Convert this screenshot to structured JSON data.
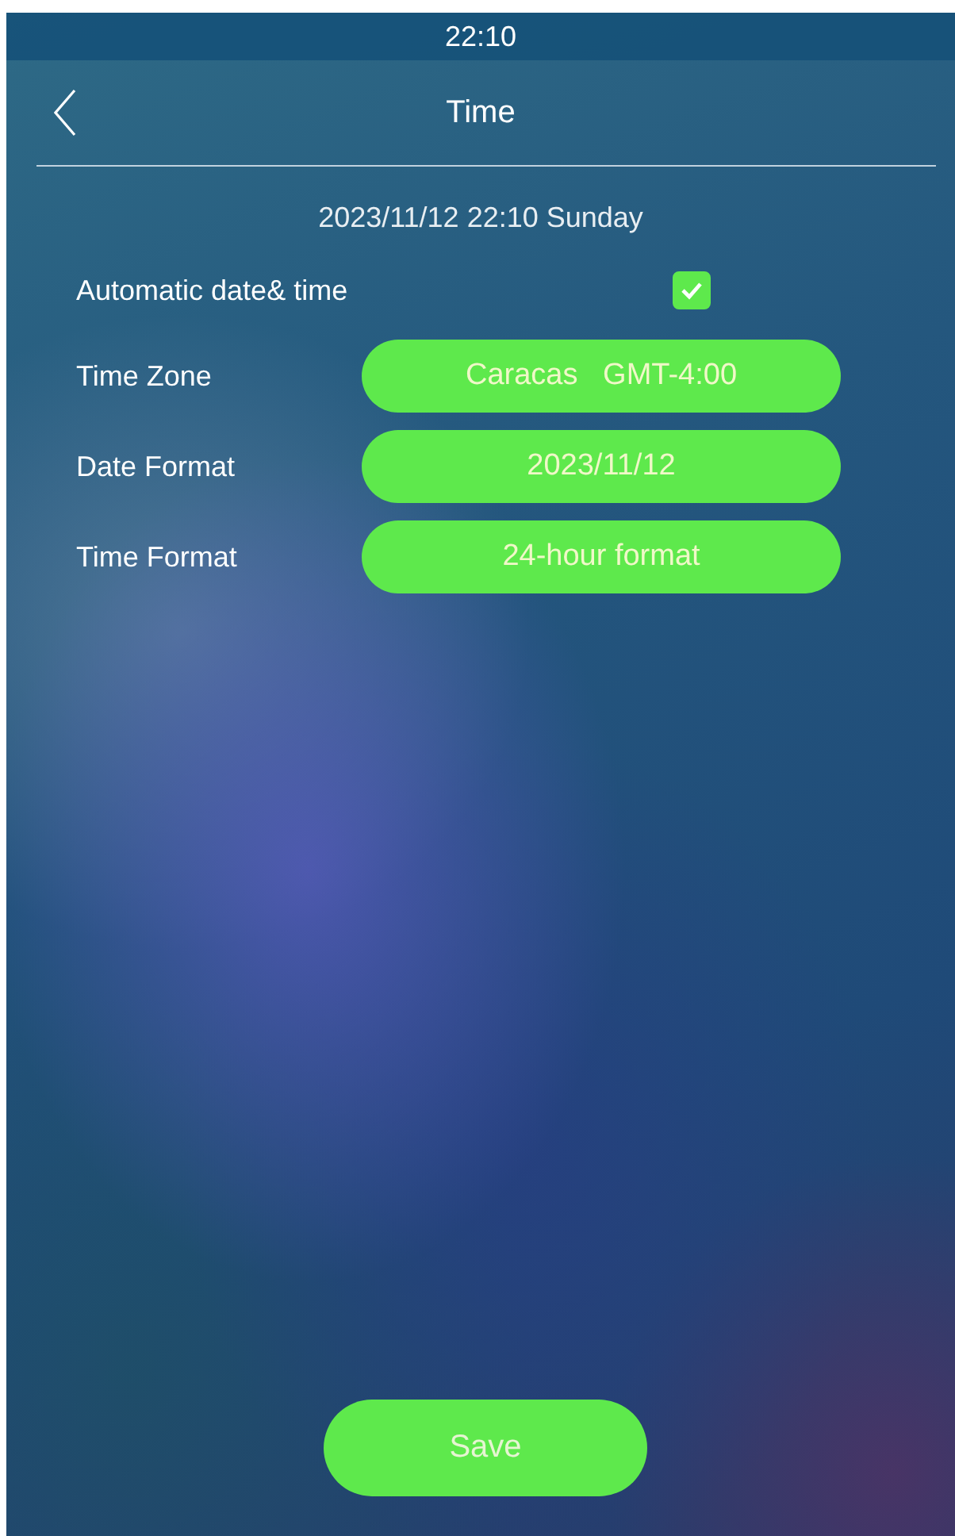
{
  "status_bar": {
    "time": "22:10"
  },
  "header": {
    "title": "Time"
  },
  "current_datetime": "2023/11/12 22:10 Sunday",
  "settings": [
    {
      "kind": "checkbox",
      "label": "Automatic date& time",
      "checked": true
    },
    {
      "kind": "select",
      "label": "Time Zone",
      "value": "Caracas   GMT-4:00"
    },
    {
      "kind": "select",
      "label": "Date Format",
      "value": "2023/11/12"
    },
    {
      "kind": "select",
      "label": "Time Format",
      "value": "24-hour format"
    }
  ],
  "save_button": "Save"
}
